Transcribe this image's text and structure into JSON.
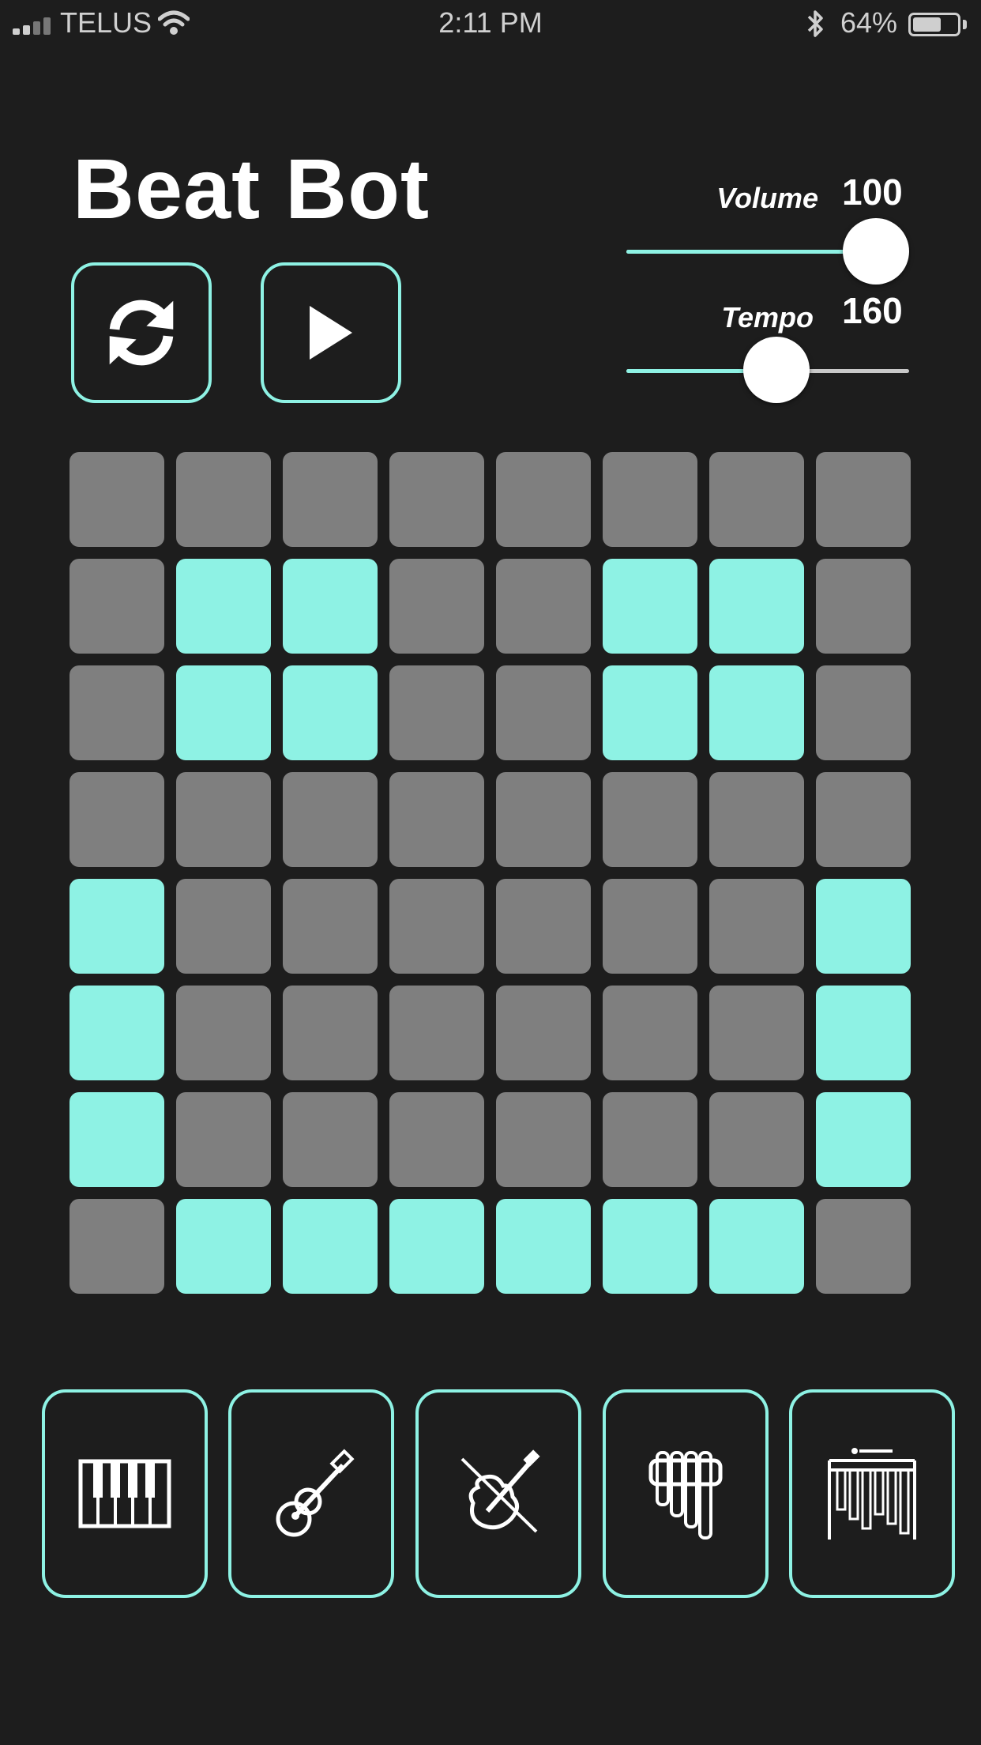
{
  "status_bar": {
    "carrier": "TELUS",
    "time": "2:11 PM",
    "battery_percent": "64%",
    "battery_level": 0.64
  },
  "app": {
    "title": "Beat Bot"
  },
  "controls": {
    "refresh_icon": "refresh-icon",
    "play_icon": "play-icon"
  },
  "volume": {
    "label": "Volume",
    "value": "100",
    "fraction": 1.0
  },
  "tempo": {
    "label": "Tempo",
    "value": "160",
    "fraction": 0.54
  },
  "grid": {
    "rows": [
      [
        0,
        0,
        0,
        0,
        0,
        0,
        0,
        0
      ],
      [
        0,
        1,
        1,
        0,
        0,
        1,
        1,
        0
      ],
      [
        0,
        1,
        1,
        0,
        0,
        1,
        1,
        0
      ],
      [
        0,
        0,
        0,
        0,
        0,
        0,
        0,
        0
      ],
      [
        1,
        0,
        0,
        0,
        0,
        0,
        0,
        1
      ],
      [
        1,
        0,
        0,
        0,
        0,
        0,
        0,
        1
      ],
      [
        1,
        0,
        0,
        0,
        0,
        0,
        0,
        1
      ],
      [
        0,
        1,
        1,
        1,
        1,
        1,
        1,
        0
      ]
    ]
  },
  "instruments": [
    {
      "icon": "piano-icon"
    },
    {
      "icon": "guitar-icon"
    },
    {
      "icon": "violin-icon"
    },
    {
      "icon": "pan-flute-icon"
    },
    {
      "icon": "xylophone-icon"
    }
  ],
  "colors": {
    "accent": "#8ef2e4",
    "cell_off": "#7f7f7f",
    "background": "#1d1d1d"
  }
}
